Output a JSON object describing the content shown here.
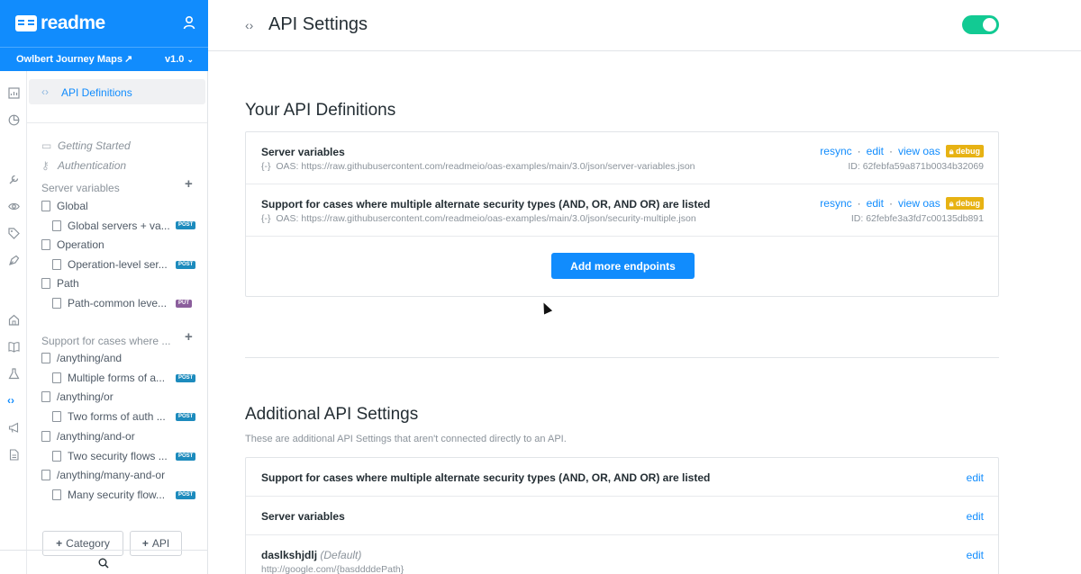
{
  "brand": {
    "logo_text": "readme",
    "color": "#118cfd"
  },
  "project": {
    "name": "Owlbert Journey Maps",
    "external_icon": "external-link-icon",
    "version": "v1.0"
  },
  "rail": {
    "icons": [
      "chart-icon",
      "pie-chart-icon",
      "wrench-icon",
      "eye-icon",
      "tag-icon",
      "pen-icon",
      "home-icon",
      "book-icon",
      "flask-icon",
      "code-icon",
      "megaphone-icon",
      "document-icon"
    ]
  },
  "sidebar": {
    "active": {
      "label": "API Definitions",
      "icon": "code-icon"
    },
    "guides": [
      {
        "label": "Getting Started",
        "icon": "book-icon"
      },
      {
        "label": "Authentication",
        "icon": "key-icon"
      }
    ],
    "apis": [
      {
        "title": "Server variables",
        "groups": [
          {
            "label": "Global",
            "page": "Global servers + va...",
            "method": "POST"
          },
          {
            "label": "Operation",
            "page": "Operation-level ser...",
            "method": "POST"
          },
          {
            "label": "Path",
            "page": "Path-common leve...",
            "method": "PUT"
          }
        ]
      },
      {
        "title": "Support for cases where ...",
        "groups": [
          {
            "label": "/anything/and",
            "page": "Multiple forms of a...",
            "method": "POST"
          },
          {
            "label": "/anything/or",
            "page": "Two forms of auth ...",
            "method": "POST"
          },
          {
            "label": "/anything/and-or",
            "page": "Two security flows ...",
            "method": "POST"
          },
          {
            "label": "/anything/many-and-or",
            "page": "Many security flow...",
            "method": "POST"
          }
        ]
      }
    ],
    "buttons": {
      "category": "Category",
      "api": "API"
    }
  },
  "header": {
    "title": "API Settings",
    "toggle_on": true,
    "toggle_color": "#12ca93"
  },
  "definitions": {
    "heading": "Your API Definitions",
    "items": [
      {
        "title": "Server variables",
        "oas_label": "OAS:",
        "oas_url": "https://raw.githubusercontent.com/readmeio/oas-examples/main/3.0/json/server-variables.json",
        "id": "ID: 62febfa59a871b0034b32069"
      },
      {
        "title": "Support for cases where multiple alternate security types (AND, OR, AND OR) are listed",
        "oas_label": "OAS:",
        "oas_url": "https://raw.githubusercontent.com/readmeio/oas-examples/main/3.0/json/security-multiple.json",
        "id": "ID: 62febfe3a3fd7c00135db891"
      }
    ],
    "actions": {
      "resync": "resync",
      "edit": "edit",
      "view": "view oas",
      "debug": "debug",
      "sep": "·"
    },
    "add_button": "Add more endpoints"
  },
  "additional": {
    "heading": "Additional API Settings",
    "subtitle": "These are additional API Settings that aren't connected directly to an API.",
    "items": [
      {
        "title": "Support for cases where multiple alternate security types (AND, OR, AND OR) are listed",
        "tag": "",
        "url": "",
        "edit": "edit"
      },
      {
        "title": "Server variables",
        "tag": "",
        "url": "",
        "edit": "edit"
      },
      {
        "title": "daslkshjdlj",
        "tag": "(Default)",
        "url": "http://google.com/{basddddePath}",
        "edit": "edit"
      }
    ]
  }
}
